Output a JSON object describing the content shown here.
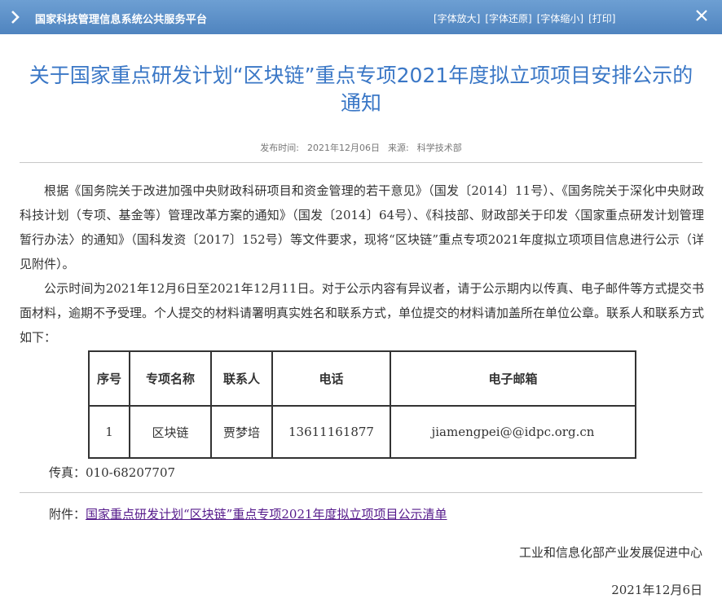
{
  "header": {
    "site_title": "国家科技管理信息系统公共服务平台",
    "tools": [
      "[字体放大]",
      "[字体还原]",
      "[字体缩小]",
      "[打印]"
    ]
  },
  "article": {
    "title": "关于国家重点研发计划“区块链”重点专项2021年度拟立项项目安排公示的通知",
    "publish_label": "发布时间:",
    "publish_date": "2021年12月06日",
    "source_label": "来源:",
    "source": "科学技术部",
    "paragraphs": [
      "根据《国务院关于改进加强中央财政科研项目和资金管理的若干意见》（国发〔2014〕11号）、《国务院关于深化中央财政科技计划（专项、基金等）管理改革方案的通知》（国发〔2014〕64号）、《科技部、财政部关于印发〈国家重点研发计划管理暂行办法〉的通知》（国科发资〔2017〕152号）等文件要求，现将“区块链”重点专项2021年度拟立项项目信息进行公示（详见附件）。",
      "公示时间为2021年12月6日至2021年12月11日。对于公示内容有异议者，请于公示期内以传真、电子邮件等方式提交书面材料，逾期不予受理。个人提交的材料请署明真实姓名和联系方式，单位提交的材料请加盖所在单位公章。联系人和联系方式如下："
    ],
    "table": {
      "headers": [
        "序号",
        "专项名称",
        "联系人",
        "电话",
        "电子邮箱"
      ],
      "rows": [
        [
          "1",
          "区块链",
          "贾梦培",
          "13611161877",
          "jiamengpei@@idpc.org.cn"
        ]
      ]
    },
    "fax": "传真：010-68207707",
    "attachment_label": "附件：",
    "attachment_link": "国家重点研发计划“区块链”重点专项2021年度拟立项项目公示清单",
    "signature": "工业和信息化部产业发展促进中心",
    "sign_date": "2021年12月6日"
  },
  "colors": {
    "header_bg": "#5a8fc8",
    "title": "#3a77c6",
    "link_visited": "#551a8b"
  },
  "icons": {
    "back": "chevron-right-icon",
    "close": "close-icon"
  }
}
